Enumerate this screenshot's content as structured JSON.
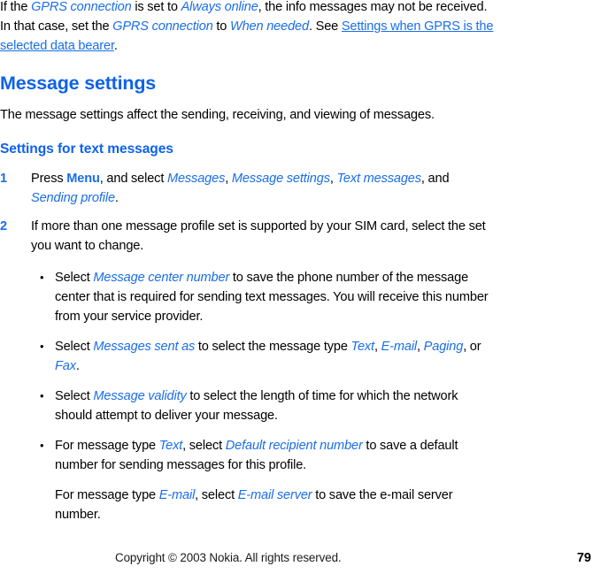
{
  "document": {
    "type": "user-guide-page",
    "accent_color": "#1a6ee8",
    "text_color": "#000000",
    "background": "#ffffff"
  },
  "intro": {
    "r1": "If the ",
    "r2": "GPRS connection",
    "r3": " is set to ",
    "r4": "Always online",
    "r5": ", the info messages may not be received. In that case, set the ",
    "r6": "GPRS connection",
    "r7": " to ",
    "r8": "When needed",
    "r9": ". See ",
    "r10": "Settings when GPRS is the selected data bearer",
    "r11": "."
  },
  "heading": {
    "title": "Message settings",
    "body": "The message settings affect the sending, receiving, and viewing of messages."
  },
  "subheading": {
    "title": "Settings for text messages"
  },
  "steps": [
    {
      "number": "1",
      "r1": "Press ",
      "r2": "Menu",
      "r3": ", and select ",
      "r4": "Messages",
      "r5": ", ",
      "r6": "Message settings",
      "r7": ", ",
      "r8": "Text messages",
      "r9": ", and ",
      "r10": "Sending profile",
      "r11": "."
    },
    {
      "number": "2",
      "r1": "If more than one message profile set is supported by your SIM card, select the set you want to change."
    }
  ],
  "bullets": [
    {
      "marker": "•",
      "r1": "Select ",
      "r2": "Message center number",
      "r3": " to save the phone number of the message center that is required for sending text messages. You will receive this number from your service provider."
    },
    {
      "marker": "•",
      "r1": "Select ",
      "r2": "Messages sent as",
      "r3": " to select the message type ",
      "r4": "Text",
      "r5": ", ",
      "r6": "E-mail",
      "r7": ", ",
      "r8": "Paging",
      "r9": ", or ",
      "r10": "Fax",
      "r11": "."
    },
    {
      "marker": "•",
      "r1": "Select ",
      "r2": "Message validity",
      "r3": " to select the length of time for which the network should attempt to deliver your message."
    },
    {
      "marker": "•",
      "r1": "For message type ",
      "r2": "Text",
      "r3": ", select ",
      "r4": "Default recipient number",
      "r5": " to save a default number for sending messages for this profile.",
      "cont": {
        "r1": "For message type ",
        "r2": "E-mail",
        "r3": ", select ",
        "r4": "E-mail server",
        "r5": " to save the e-mail server number."
      }
    }
  ],
  "footer": {
    "copyright": "Copyright © 2003 Nokia. All rights reserved.",
    "page_number": "79"
  }
}
